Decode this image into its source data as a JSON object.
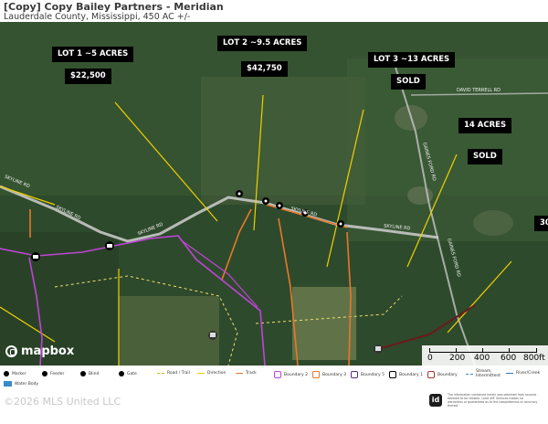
{
  "header": {
    "title": "[Copy] Copy Bailey Partners - Meridian",
    "subtitle": "Lauderdale County, Mississippi, 450 AC +/-"
  },
  "map": {
    "lots": [
      {
        "label": "LOT 1 ~5 ACRES",
        "status": "$22,500"
      },
      {
        "label": "LOT 2 ~9.5 ACRES",
        "status": "$42,750"
      },
      {
        "label": "LOT 3 ~13 ACRES",
        "status": "SOLD"
      },
      {
        "label": "14 ACRES",
        "status": "SOLD"
      }
    ],
    "partial_label": "30",
    "road_labels": [
      "SKYLINE RD",
      "SKYLINE RD",
      "SKYLINE RD",
      "SKYLINE RD",
      "SKYLINE RD",
      "DAVID TERRELL RD",
      "GAINES FORD RD",
      "GAINES FORD RD"
    ],
    "attribution": "mapbox",
    "scale": {
      "labels": [
        "0",
        "200",
        "400",
        "600",
        "800ft"
      ]
    }
  },
  "legend": {
    "items": [
      {
        "label": "Marker",
        "icon": "marker-icon"
      },
      {
        "label": "Feeder",
        "icon": "feeder-icon"
      },
      {
        "label": "Blind",
        "icon": "blind-icon"
      },
      {
        "label": "Gate",
        "icon": "gate-icon"
      },
      {
        "label": "Road / Trail",
        "icon": "road-trail-icon"
      },
      {
        "label": "Direction",
        "icon": "direction-icon"
      },
      {
        "label": "Track",
        "icon": "track-icon"
      },
      {
        "label": "Boundary 2",
        "icon": "boundary-2-icon"
      },
      {
        "label": "Boundary 3",
        "icon": "boundary-3-icon"
      },
      {
        "label": "Boundary 5",
        "icon": "boundary-5-icon"
      },
      {
        "label": "Boundary 1",
        "icon": "boundary-1-icon"
      },
      {
        "label": "Boundary",
        "icon": "boundary-icon"
      },
      {
        "label": "Stream, Intermittent",
        "icon": "stream-intermittent-icon"
      },
      {
        "label": "River/Creek",
        "icon": "river-creek-icon"
      },
      {
        "label": "Water Body",
        "icon": "water-body-icon"
      }
    ]
  },
  "footer": {
    "copyright": "©2026 MLS United LLC",
    "badge": "id",
    "disclaimer": "The information contained herein was obtained from sources deemed to be reliable. Land id® Services makes no warranties or guarantees as to the completeness or accuracy thereof."
  },
  "colors": {
    "yellow": "#f0d000",
    "orange": "#e8782a",
    "purple": "#c044d8",
    "road": "#d9d9d9",
    "darkred": "#6a1a1a"
  }
}
